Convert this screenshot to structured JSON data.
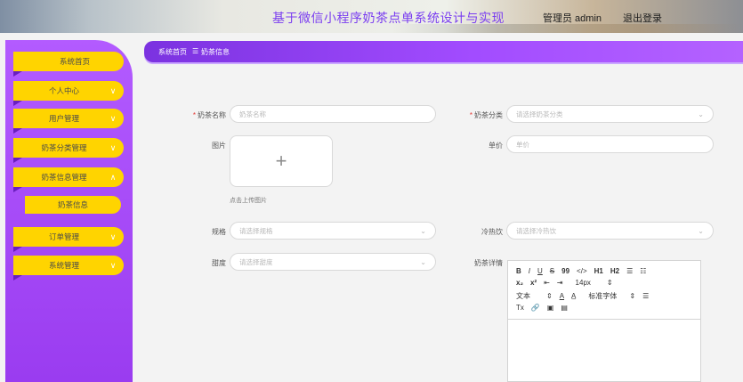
{
  "header": {
    "site_title": "基于微信小程序奶茶点单系统设计与实现",
    "admin_label": "管理员 admin",
    "logout_label": "退出登录"
  },
  "sidebar": {
    "items": [
      {
        "label": "系统首页"
      },
      {
        "label": "个人中心",
        "chevron": "∨"
      },
      {
        "label": "用户管理",
        "chevron": "∨"
      },
      {
        "label": "奶茶分类管理",
        "chevron": "∨"
      },
      {
        "label": "奶茶信息管理",
        "chevron": "∧"
      },
      {
        "label": "订单管理",
        "chevron": "∨"
      },
      {
        "label": "系统管理",
        "chevron": "∨"
      }
    ],
    "sub_item": {
      "label": "奶茶信息"
    }
  },
  "breadcrumb": {
    "home": "系统首页",
    "separator": "☰",
    "current": "奶茶信息"
  },
  "form": {
    "name": {
      "required": "*",
      "label": "奶茶名称",
      "placeholder": "奶茶名称"
    },
    "category": {
      "required": "*",
      "label": "奶茶分类",
      "placeholder": "请选择奶茶分类"
    },
    "image": {
      "label": "图片",
      "tip": "点击上传图片"
    },
    "price": {
      "label": "单价",
      "placeholder": "单价"
    },
    "spec": {
      "label": "规格",
      "placeholder": "请选择规格"
    },
    "temp": {
      "label": "冷热饮",
      "placeholder": "请选择冷热饮"
    },
    "sweet": {
      "label": "甜度",
      "placeholder": "请选择甜度"
    },
    "detail": {
      "label": "奶茶详情"
    }
  },
  "editor": {
    "row1": [
      "B",
      "I",
      "U",
      "S",
      "99",
      "</>",
      "H1",
      "H2",
      "☰",
      "☷"
    ],
    "row2": [
      "x₂",
      "x²",
      "⇤",
      "⇥",
      "14px",
      "⇕"
    ],
    "row3": [
      "文本",
      "⇕",
      "A",
      "A̲",
      "标准字体",
      "⇕",
      "☰"
    ],
    "row4": [
      "Tx",
      "🔗",
      "▣",
      "▤"
    ]
  },
  "colors": {
    "accent_purple": "#a24cff",
    "accent_yellow": "#ffd400",
    "title_color": "#7a3df0"
  }
}
